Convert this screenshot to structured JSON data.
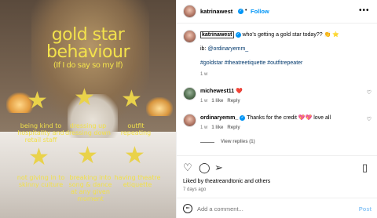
{
  "image": {
    "title_line1": "gold star",
    "title_line2": "behaviour",
    "title_sub": "(If I do say so my    lf)",
    "captions": [
      "being kind to hospitality and retail staff",
      "dressing up dressing down",
      "outfit repeating",
      "not giving in to skinny culture",
      "breaking into song & dance at any given moment",
      "having theatre etiquette"
    ],
    "accent": "#f1e04a"
  },
  "header": {
    "username": "katrinawest",
    "separator": "•",
    "follow": "Follow",
    "more": "•••"
  },
  "caption": {
    "username": "katrinawest",
    "text": "who's getting a gold star today?? 👏 ⭐",
    "ib_prefix": "ib: ",
    "ib_handle": "@ordinaryemm_",
    "hashtags": "#goldstar #theatreetiquette #outfitrepeater",
    "time": "1 w"
  },
  "comments": [
    {
      "username": "michewest11",
      "emoji": "❤️",
      "time": "1 w",
      "likes": "1 like",
      "reply": "Reply"
    },
    {
      "username": "ordinaryemm_",
      "text": "Thanks for the credit 💖💖 love all",
      "time": "1 w",
      "likes": "1 like",
      "reply": "Reply",
      "view_replies": "View replies (1)"
    }
  ],
  "actions": {
    "likes_text": "Liked by theatreandtonic and others",
    "time_ago": "7 days ago"
  },
  "add_comment": {
    "placeholder": "Add a comment...",
    "post": "Post"
  },
  "colors": {
    "link": "#00376b",
    "blue": "#0095f6",
    "muted": "#737373"
  }
}
